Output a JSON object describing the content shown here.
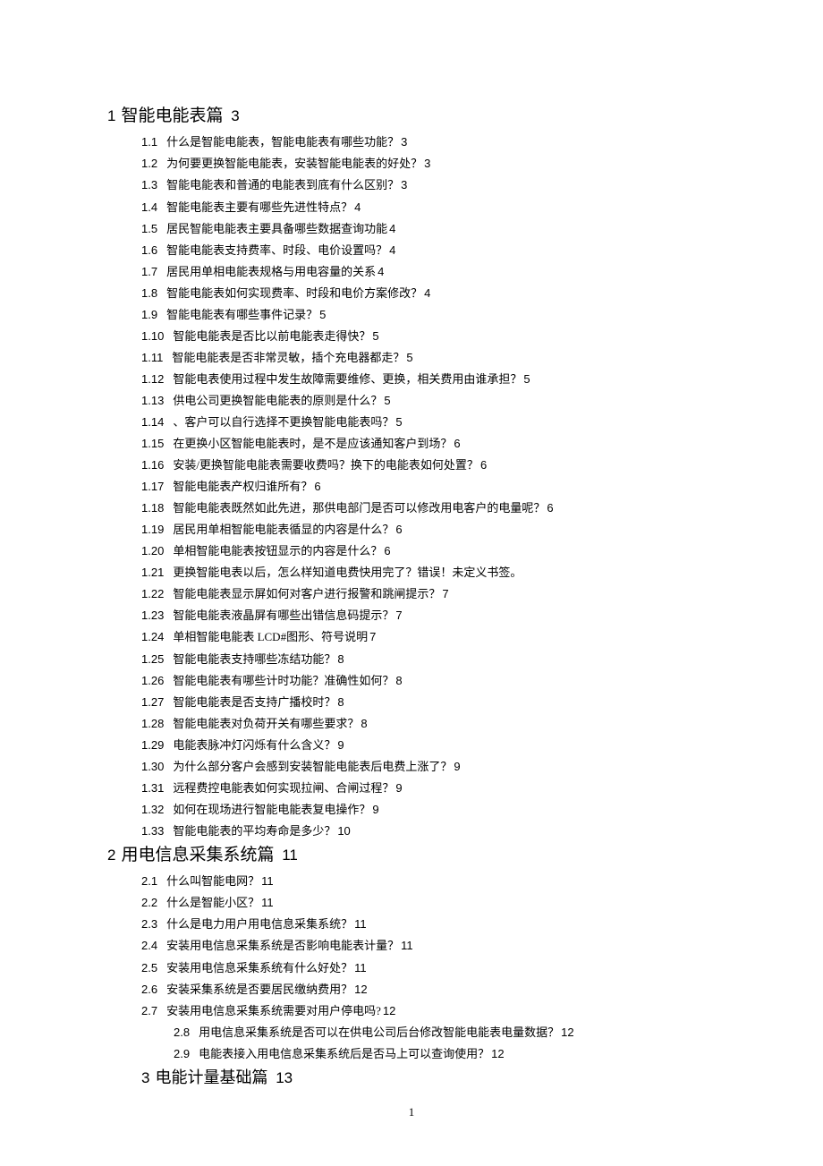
{
  "sections": [
    {
      "num": "1",
      "title": "智能电能表篇",
      "page": "3",
      "indent": false,
      "items": [
        {
          "num": "1.1",
          "label": "什么是智能电能表，智能电能表有哪些功能？",
          "page": "3"
        },
        {
          "num": "1.2",
          "label": "为何要更换智能电能表，安装智能电能表的好处？",
          "page": "3"
        },
        {
          "num": "1.3",
          "label": "智能电能表和普通的电能表到底有什么区别？",
          "page": "3"
        },
        {
          "num": "1.4",
          "label": "智能电能表主要有哪些先进性特点？",
          "page": "4"
        },
        {
          "num": "1.5",
          "label": "居民智能电能表主要具备哪些数据查询功能",
          "page": "4"
        },
        {
          "num": "1.6",
          "label": "智能电能表支持费率、时段、电价设置吗？",
          "page": "4"
        },
        {
          "num": "1.7",
          "label": "居民用单相电能表规格与用电容量的关系",
          "page": "4"
        },
        {
          "num": "1.8",
          "label": "智能电能表如何实现费率、时段和电价方案修改？",
          "page": "4"
        },
        {
          "num": "1.9",
          "label": "智能电能表有哪些事件记录？",
          "page": "5"
        },
        {
          "num": "1.10",
          "label": "智能电能表是否比以前电能表走得快？",
          "page": "5"
        },
        {
          "num": "1.11",
          "label": "智能电能表是否非常灵敏，插个充电器都走？",
          "page": "5"
        },
        {
          "num": "1.12",
          "label": "智能电表使用过程中发生故障需要维修、更换，相关费用由谁承担？",
          "page": "5"
        },
        {
          "num": "1.13",
          "label": "供电公司更换智能电能表的原则是什么？",
          "page": "5"
        },
        {
          "num": "1.14",
          "label": "、客户可以自行选择不更换智能电能表吗？",
          "page": "5"
        },
        {
          "num": "1.15",
          "label": "在更换小区智能电能表时，是不是应该通知客户到场？",
          "page": "6"
        },
        {
          "num": "1.16",
          "label": "安装/更换智能电能表需要收费吗？换下的电能表如何处置？",
          "page": "6"
        },
        {
          "num": "1.17",
          "label": "智能电能表产权归谁所有？",
          "page": "6"
        },
        {
          "num": "1.18",
          "label": "智能电能表既然如此先进，那供电部门是否可以修改用电客户的电量呢？",
          "page": "6"
        },
        {
          "num": "1.19",
          "label": "居民用单相智能电能表循显的内容是什么？",
          "page": "6"
        },
        {
          "num": "1.20",
          "label": "单相智能电能表按钮显示的内容是什么？",
          "page": "6"
        },
        {
          "num": "1.21",
          "label": "更换智能电表以后，怎么样知道电费快用完了？错误！未定义书签。",
          "page": ""
        },
        {
          "num": "1.22",
          "label": "智能电能表显示屏如何对客户进行报警和跳闸提示？",
          "page": "7"
        },
        {
          "num": "1.23",
          "label": "智能电能表液晶屏有哪些出错信息码提示？",
          "page": "7"
        },
        {
          "num": "1.24",
          "label": "单相智能电能表 LCD#图形、符号说明",
          "page": "7"
        },
        {
          "num": "1.25",
          "label": "智能电能表支持哪些冻结功能？",
          "page": "8"
        },
        {
          "num": "1.26",
          "label": "智能电能表有哪些计时功能？准确性如何？",
          "page": "8"
        },
        {
          "num": "1.27",
          "label": "智能电能表是否支持广播校时？",
          "page": "8"
        },
        {
          "num": "1.28",
          "label": "智能电能表对负荷开关有哪些要求？",
          "page": "8"
        },
        {
          "num": "1.29",
          "label": "电能表脉冲灯闪烁有什么含义？",
          "page": "9"
        },
        {
          "num": "1.30",
          "label": "为什么部分客户会感到安装智能电能表后电费上涨了？",
          "page": "9"
        },
        {
          "num": "1.31",
          "label": "远程费控电能表如何实现拉闸、合闸过程？",
          "page": "9"
        },
        {
          "num": "1.32",
          "label": "如何在现场进行智能电能表复电操作？",
          "page": "9"
        },
        {
          "num": "1.33",
          "label": "智能电能表的平均寿命是多少？",
          "page": "10"
        }
      ]
    },
    {
      "num": "2",
      "title": "用电信息采集系统篇",
      "page": "11",
      "indent": false,
      "items": [
        {
          "num": "2.1",
          "label": "什么叫智能电网？",
          "page": "11"
        },
        {
          "num": "2.2",
          "label": "什么是智能小区？",
          "page": "11"
        },
        {
          "num": "2.3",
          "label": "什么是电力用户用电信息采集系统？",
          "page": "11"
        },
        {
          "num": "2.4",
          "label": "安装用电信息采集系统是否影响电能表计量？",
          "page": "11"
        },
        {
          "num": "2.5",
          "label": "安装用电信息采集系统有什么好处？",
          "page": "11"
        },
        {
          "num": "2.6",
          "label": "安装采集系统是否要居民缴纳费用？",
          "page": "12"
        },
        {
          "num": "2.7",
          "label": "安装用电信息采集系统需要对用户停电吗?",
          "page": "12"
        },
        {
          "num": "2.8",
          "label": "用电信息采集系统是否可以在供电公司后台修改智能电能表电量数据？",
          "page": "12",
          "indent": true
        },
        {
          "num": "2.9",
          "label": "电能表接入用电信息采集系统后是否马上可以查询使用？",
          "page": "12",
          "indent": true
        }
      ]
    },
    {
      "num": "3",
      "title": "电能计量基础篇",
      "page": "13",
      "indent": true,
      "items": []
    }
  ],
  "footer": "1"
}
